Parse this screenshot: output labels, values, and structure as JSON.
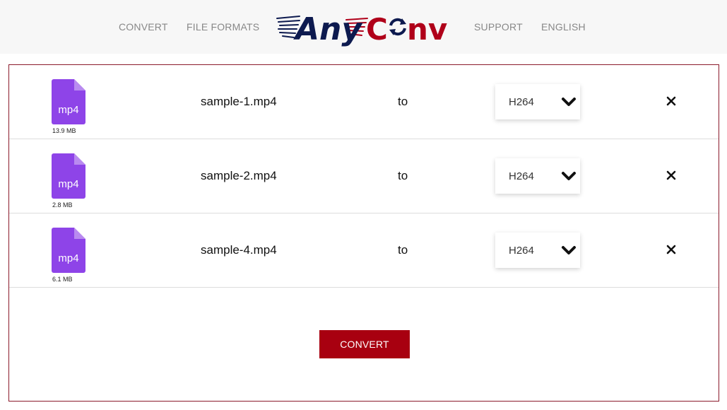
{
  "nav": {
    "left": [
      {
        "label": "CONVERT"
      },
      {
        "label": "FILE FORMATS"
      }
    ],
    "right": [
      {
        "label": "SUPPORT"
      },
      {
        "label": "ENGLISH"
      }
    ],
    "logo": {
      "part1": "Any",
      "part2": "C",
      "part3": "nv",
      "color_navy": "#0d1a4f",
      "color_red": "#b0001a"
    }
  },
  "files": [
    {
      "icon": "mp4-file-icon",
      "ext": "mp4",
      "size": "13.9 MB",
      "name": "sample-1.mp4",
      "to": "to",
      "format": "H264"
    },
    {
      "icon": "mp4-file-icon",
      "ext": "mp4",
      "size": "2.8 MB",
      "name": "sample-2.mp4",
      "to": "to",
      "format": "H264"
    },
    {
      "icon": "mp4-file-icon",
      "ext": "mp4",
      "size": "6.1 MB",
      "name": "sample-4.mp4",
      "to": "to",
      "format": "H264"
    }
  ],
  "actions": {
    "convert_label": "CONVERT"
  },
  "colors": {
    "file_icon": "#8e44e8",
    "file_icon_fold": "#b98af0",
    "accent": "#a80010",
    "panel_border": "#8b1a2b"
  }
}
